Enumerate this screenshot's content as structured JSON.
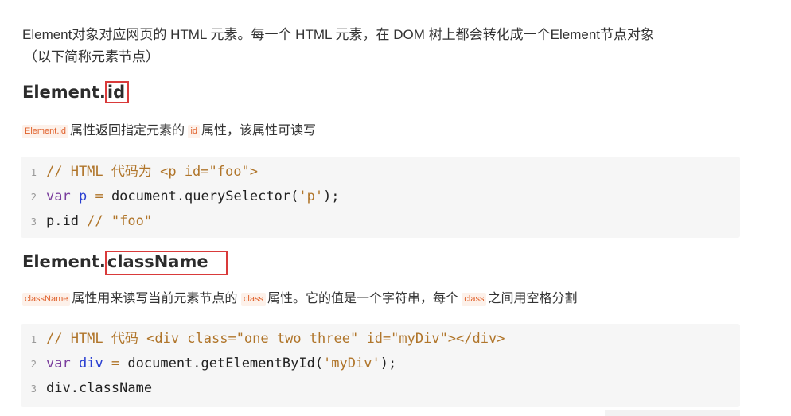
{
  "intro": {
    "line1": "Element对象对应网页的 HTML 元素。每一个 HTML 元素，在 DOM 树上都会转化成一个Element节点对象",
    "line2": "（以下简称元素节点）"
  },
  "section_id": {
    "heading_prefix": "Element.",
    "heading_highlight": "id",
    "tag1": "Element.id",
    "text1": "属性返回指定元素的",
    "tag2": "id",
    "text2": "属性，该属性可读写",
    "code": {
      "ln1": "1",
      "ln2": "2",
      "ln3": "3",
      "l1_comment": "// HTML 代码为 <p id=\"foo\">",
      "l2_kw": "var",
      "l2_var": "p",
      "l2_eq": " = ",
      "l2_call": "document.querySelector(",
      "l2_str": "'p'",
      "l2_end": ");",
      "l3_id": "p.id ",
      "l3_comment": "// \"foo\""
    }
  },
  "section_class": {
    "heading_prefix": "Element.",
    "heading_highlight": "className",
    "tag1": "className",
    "text1": "属性用来读写当前元素节点的",
    "tag2": "class",
    "text2": "属性。它的值是一个字符串，每个",
    "tag3": "class",
    "text3": "之间用空格分割",
    "code": {
      "ln1": "1",
      "ln2": "2",
      "ln3": "3",
      "l1_comment": "// HTML 代码 <div class=\"one two three\" id=\"myDiv\"></div>",
      "l2_kw": "var",
      "l2_var": "div",
      "l2_eq": " = ",
      "l2_call": "document.getElementById(",
      "l2_str": "'myDiv'",
      "l2_end": ");",
      "l3_id": "div.className"
    }
  },
  "colors": {
    "highlight_border": "#d93a3a",
    "inline_tag_bg": "#fdf1ea",
    "inline_tag_text": "#e0602a",
    "code_bg": "#f6f6f6"
  }
}
